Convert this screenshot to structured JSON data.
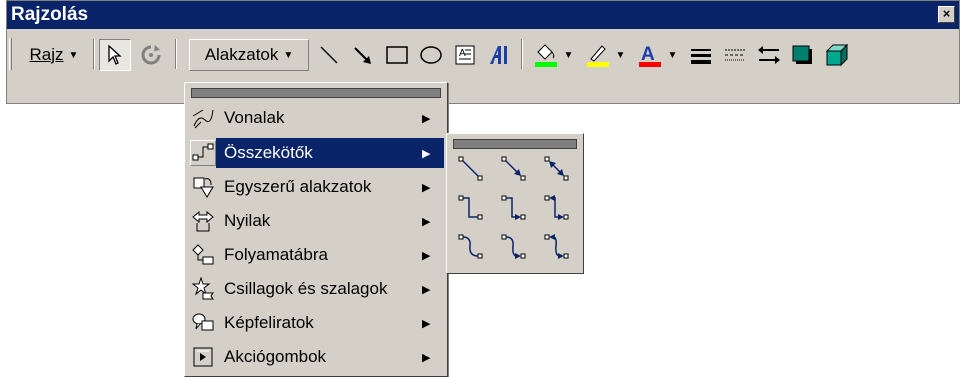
{
  "window": {
    "title": "Rajzolás",
    "close_label": "×"
  },
  "toolbar": {
    "draw_menu": "Rajz",
    "shapes_menu": "Alakzatok",
    "icons": [
      "select-pointer-icon",
      "free-rotate-icon",
      "line-icon",
      "arrow-icon",
      "rectangle-icon",
      "oval-icon",
      "text-box-icon",
      "wordart-icon",
      "fill-color-icon",
      "line-color-icon",
      "font-color-icon",
      "line-style-icon",
      "dash-style-icon",
      "arrow-style-icon",
      "shadow-icon",
      "3d-icon"
    ],
    "colors": {
      "fill": "#00ff00",
      "line": "#ffff00",
      "font": "#ff0000"
    }
  },
  "menu": {
    "items": [
      {
        "label": "Vonalak",
        "icon": "lines-icon"
      },
      {
        "label": "Összekötők",
        "icon": "connectors-icon",
        "selected": true
      },
      {
        "label": "Egyszerű alakzatok",
        "icon": "basic-shapes-icon"
      },
      {
        "label": "Nyilak",
        "icon": "block-arrows-icon"
      },
      {
        "label": "Folyamatábra",
        "icon": "flowchart-icon"
      },
      {
        "label": "Csillagok és szalagok",
        "icon": "stars-banners-icon"
      },
      {
        "label": "Képfeliratok",
        "icon": "callouts-icon"
      },
      {
        "label": "Akciógombok",
        "icon": "action-buttons-icon"
      }
    ]
  },
  "submenu": {
    "items": [
      "straight-connector-icon",
      "straight-arrow-connector-icon",
      "straight-double-arrow-connector-icon",
      "elbow-connector-icon",
      "elbow-arrow-connector-icon",
      "elbow-double-arrow-connector-icon",
      "curved-connector-icon",
      "curved-arrow-connector-icon",
      "curved-double-arrow-connector-icon"
    ]
  },
  "theme": {
    "face": "#d4d0c8",
    "highlight": "#0a246a"
  }
}
